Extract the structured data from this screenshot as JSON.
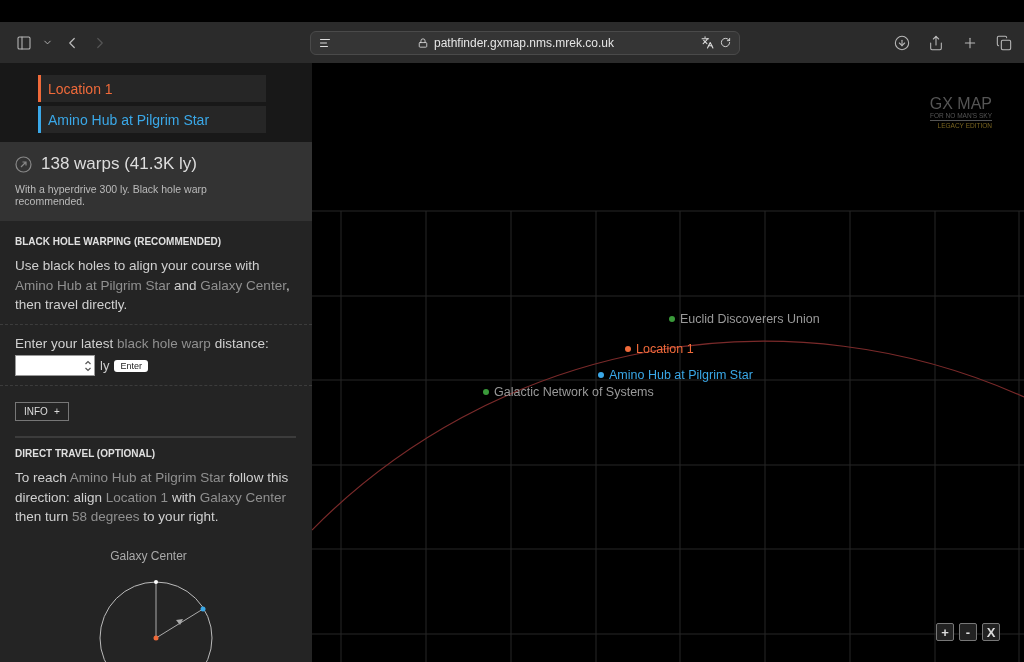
{
  "browser": {
    "url": "pathfinder.gxmap.nms.mrek.co.uk",
    "back_disabled": false,
    "forward_disabled": true
  },
  "route": [
    {
      "name": "Location 1",
      "color": "#f06a3a"
    },
    {
      "name": "Amino Hub at Pilgrim Star",
      "color": "#3aa8e8"
    }
  ],
  "summary": {
    "title": "138 warps (41.3K ly)",
    "detail": "With a hyperdrive 300 ly. Black hole warp recommended."
  },
  "black_hole": {
    "heading": "BLACK HOLE WARPING (RECOMMENDED)",
    "text": [
      {
        "t": "Use black holes to align your course with ",
        "hl": false
      },
      {
        "t": "Amino Hub at Pilgrim Star",
        "hl": true
      },
      {
        "t": " and ",
        "hl": false
      },
      {
        "t": "Galaxy Center",
        "hl": true
      },
      {
        "t": ", then travel directly.",
        "hl": false
      }
    ],
    "prompt": [
      {
        "t": "Enter your latest ",
        "hl": false
      },
      {
        "t": "black hole warp",
        "hl": true
      },
      {
        "t": " distance:",
        "hl": false
      }
    ],
    "unit": "ly",
    "enter_button": "Enter",
    "info_button": "INFO",
    "info_icon": "+"
  },
  "direct": {
    "heading": "DIRECT TRAVEL (OPTIONAL)",
    "text": [
      {
        "t": "To reach ",
        "hl": false
      },
      {
        "t": "Amino Hub at Pilgrim Star",
        "hl": true
      },
      {
        "t": " follow this direction: align ",
        "hl": false
      },
      {
        "t": "Location 1",
        "hl": true
      },
      {
        "t": " with ",
        "hl": false
      },
      {
        "t": "Galaxy Center",
        "hl": true
      },
      {
        "t": " then turn ",
        "hl": false
      },
      {
        "t": "58 degrees",
        "hl": true
      },
      {
        "t": " to your right.",
        "hl": false
      }
    ],
    "compass_label": "Galaxy Center"
  },
  "logo": {
    "title": "GX MAP",
    "subtitle": "FOR NO MAN'S SKY",
    "edition": "LEGACY EDITION"
  },
  "markers": [
    {
      "name": "Euclid Discoverers Union",
      "color": "#3a9a3a"
    },
    {
      "name": "Location 1",
      "color": "#f06a3a"
    },
    {
      "name": "Amino Hub at Pilgrim Star",
      "color": "#3aa8e8"
    },
    {
      "name": "Galactic Network of Systems",
      "color": "#3a9a3a"
    }
  ],
  "zoom_controls": [
    "+",
    "-",
    "X"
  ]
}
